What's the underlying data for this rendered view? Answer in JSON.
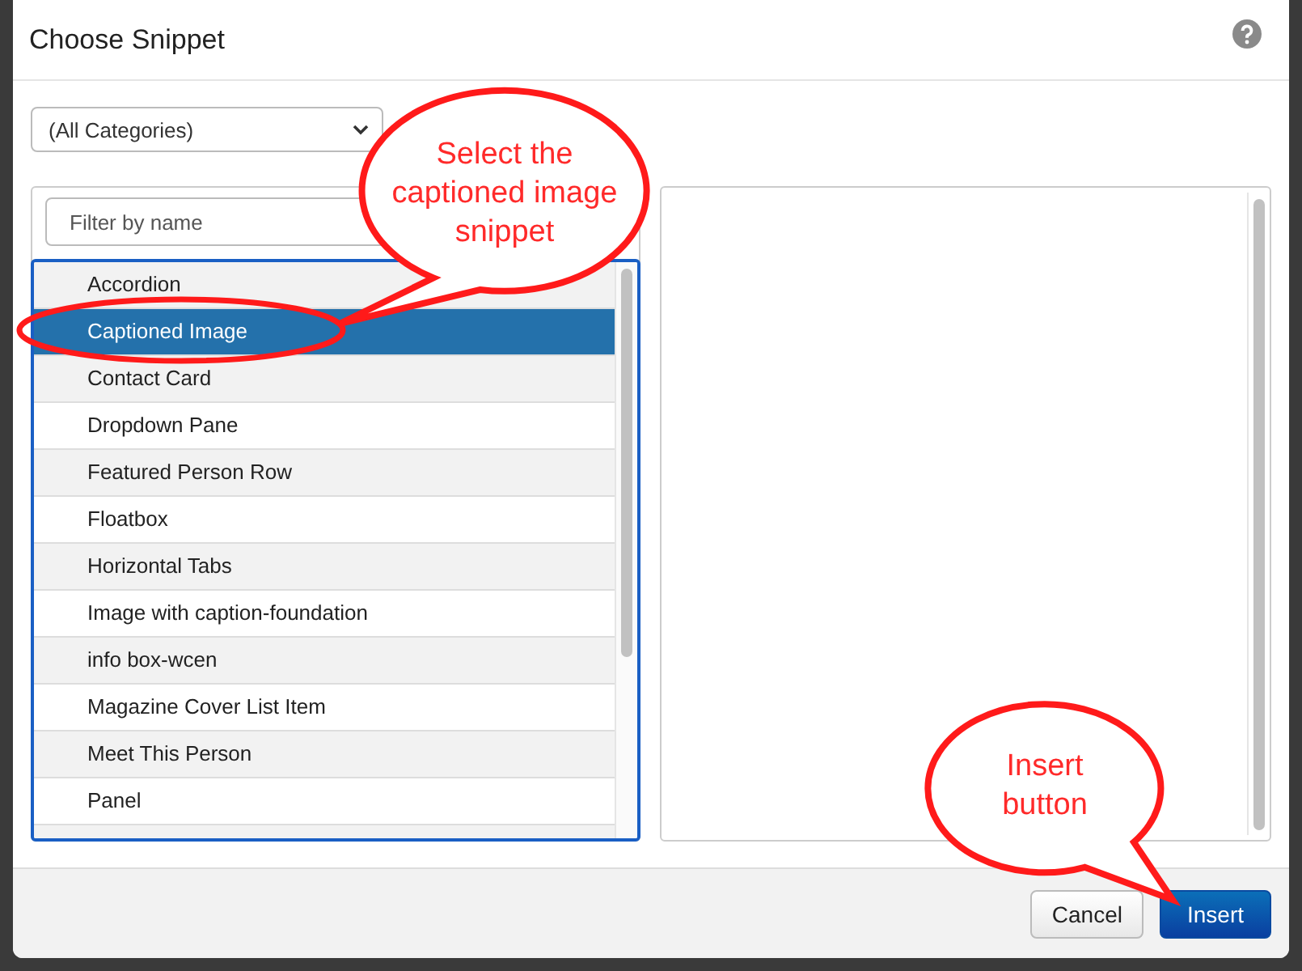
{
  "dialog": {
    "title": "Choose Snippet"
  },
  "category_select": {
    "value": "(All Categories)"
  },
  "filter": {
    "placeholder": "Filter by name"
  },
  "snippets": [
    {
      "label": "Accordion",
      "selected": false
    },
    {
      "label": "Captioned Image",
      "selected": true
    },
    {
      "label": "Contact Card",
      "selected": false
    },
    {
      "label": "Dropdown Pane",
      "selected": false
    },
    {
      "label": "Featured Person Row",
      "selected": false
    },
    {
      "label": "Floatbox",
      "selected": false
    },
    {
      "label": "Horizontal Tabs",
      "selected": false
    },
    {
      "label": "Image with caption-foundation",
      "selected": false
    },
    {
      "label": "info box-wcen",
      "selected": false
    },
    {
      "label": "Magazine Cover List Item",
      "selected": false
    },
    {
      "label": "Meet This Person",
      "selected": false
    },
    {
      "label": "Panel",
      "selected": false
    }
  ],
  "buttons": [
    {
      "label": "Cancel",
      "kind": "secondary"
    },
    {
      "label": "Insert",
      "kind": "primary"
    }
  ],
  "annotations": [
    {
      "text": "Select the captioned image snippet"
    },
    {
      "text": "Insert button"
    }
  ]
}
